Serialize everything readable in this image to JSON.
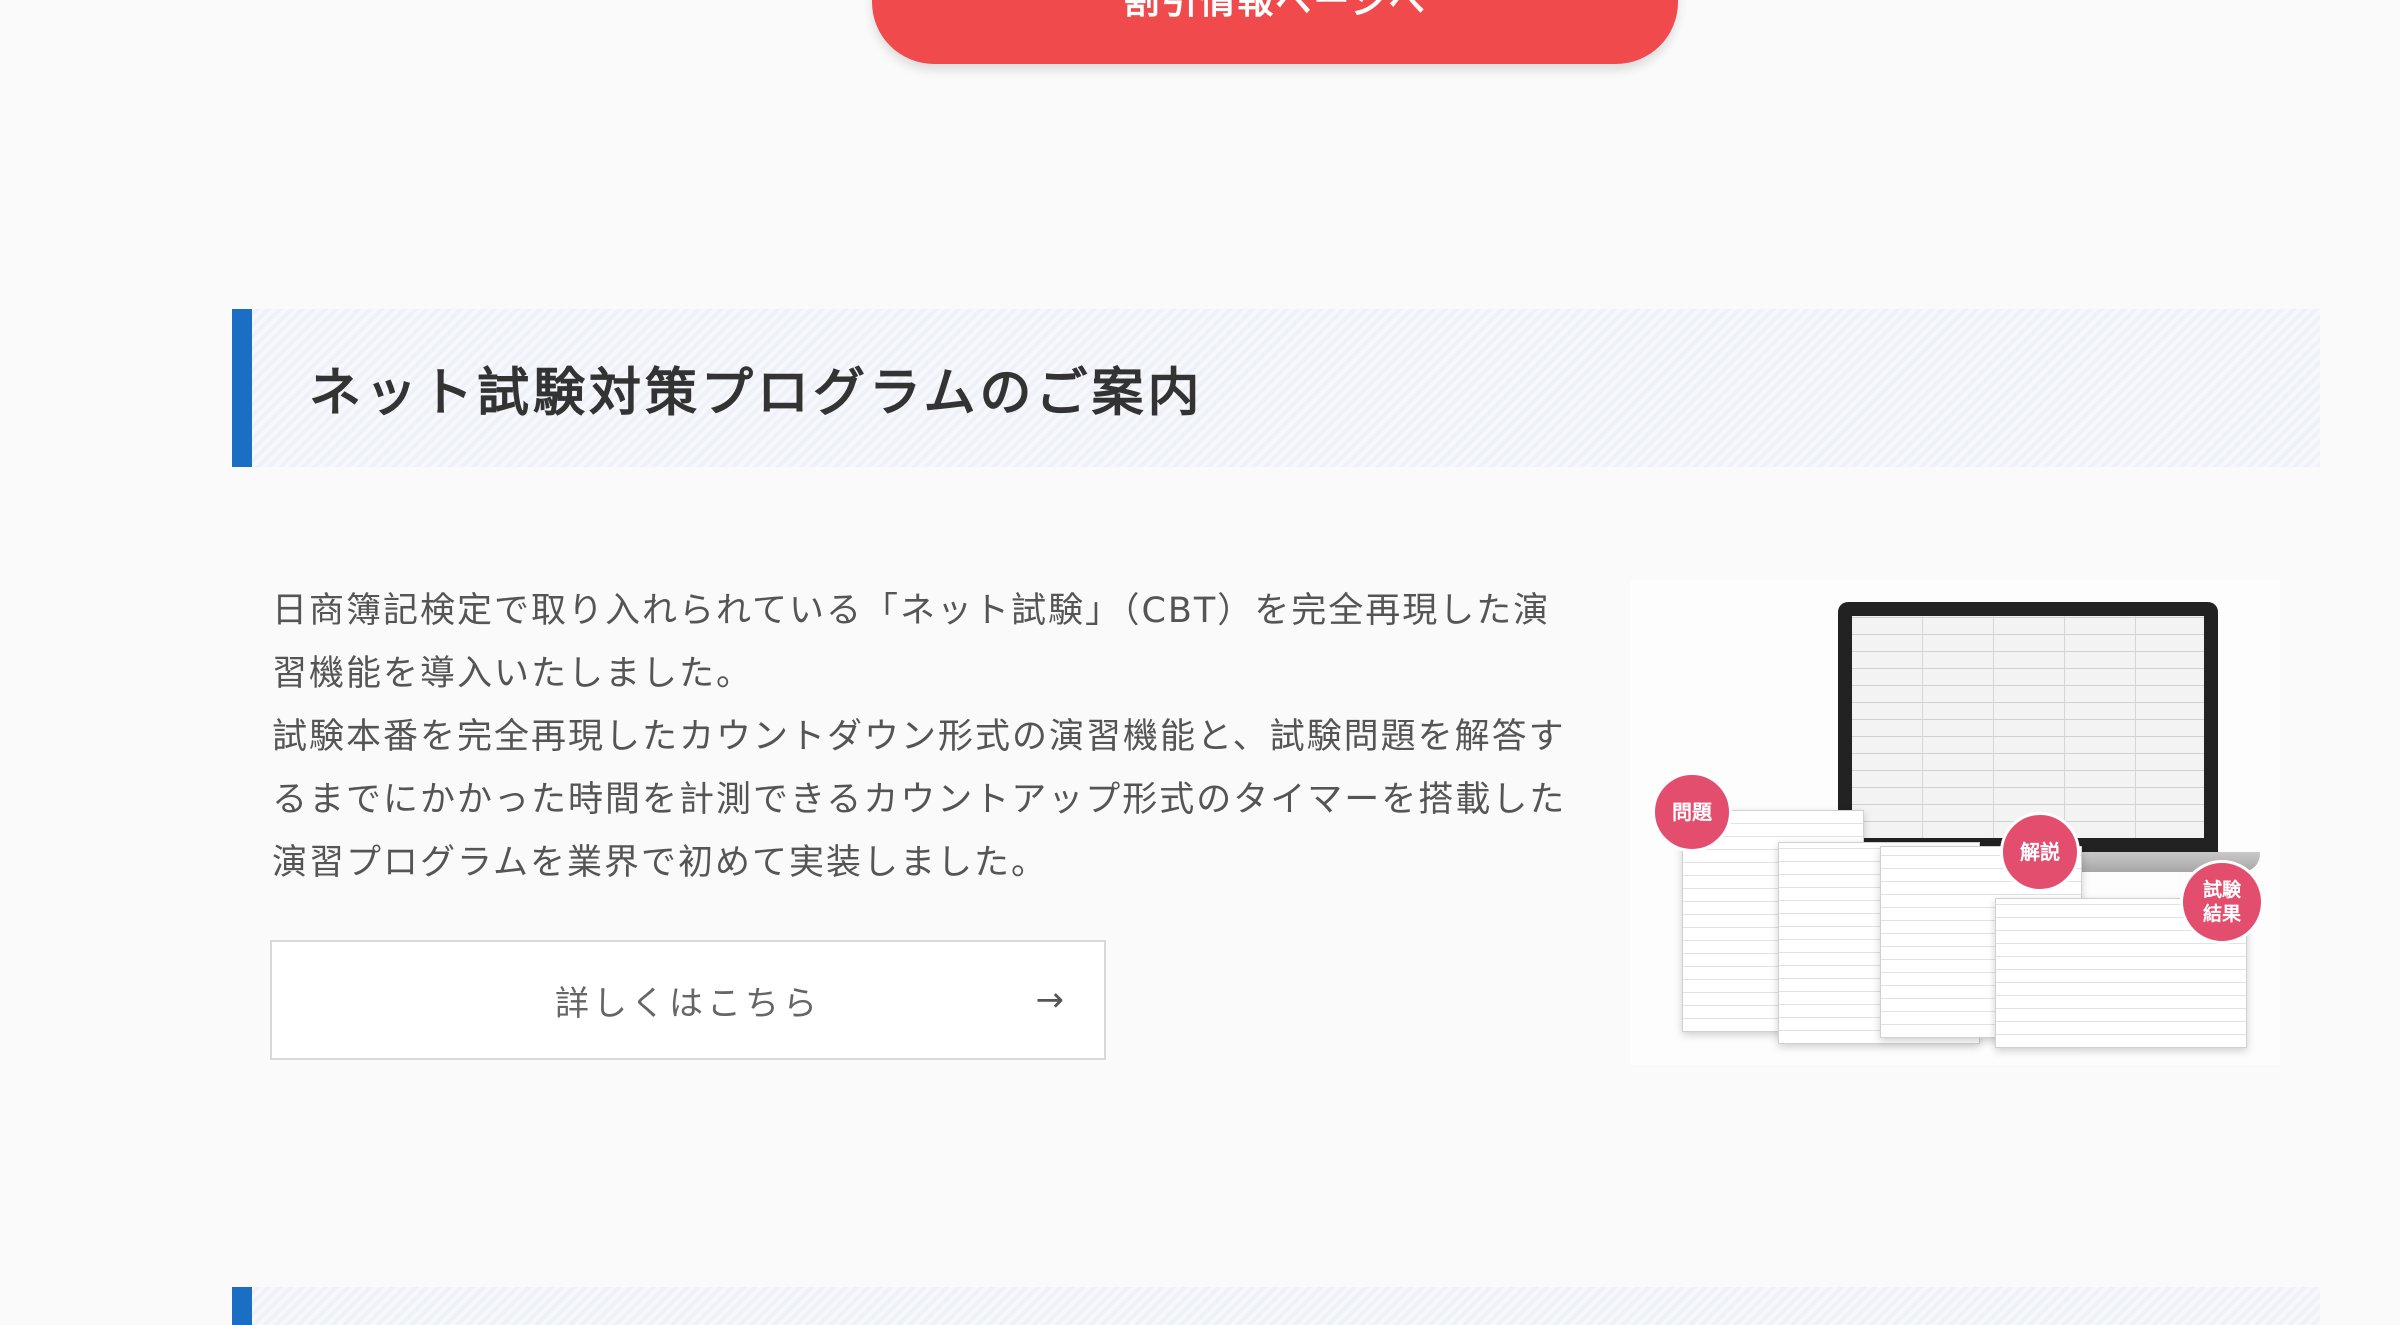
{
  "top_button": {
    "label": "割引情報ページへ"
  },
  "section": {
    "title": "ネット試験対策プログラムのご案内",
    "paragraphs": [
      "日商簿記検定で取り入れられている「ネット試験」（CBT）を完全再現した演習機能を導入いたしました。",
      "試験本番を完全再現したカウントダウン形式の演習機能と、試験問題を解答するまでにかかった時間を計測できるカウントアップ形式のタイマーを搭載した演習プログラムを業界で初めて実装しました。"
    ],
    "detail_button": {
      "label": "詳しくはこちら",
      "arrow": "→"
    },
    "illustration": {
      "badges": [
        "問題",
        "解説",
        "試験\n結果"
      ]
    }
  },
  "colors": {
    "accent_blue": "#1a6fc4",
    "button_red": "#f04a4d",
    "badge_pink": "#e34d6e"
  }
}
